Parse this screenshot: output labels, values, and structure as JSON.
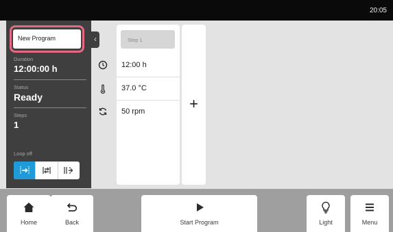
{
  "status_bar": {
    "time": "20:05"
  },
  "sidebar": {
    "program_name": "New Program",
    "duration_label": "Duration",
    "duration_value": "12:00:00 h",
    "status_label": "Status",
    "status_value": "Ready",
    "steps_label": "Steps",
    "steps_value": "1",
    "loop_label": "Loop off",
    "loop_modes": [
      {
        "icon": "loop-off-icon",
        "active": true
      },
      {
        "icon": "loop-all-icon",
        "active": false
      },
      {
        "icon": "loop-step-icon",
        "active": false
      }
    ],
    "collapse_icon": "‹"
  },
  "parameter_icons": [
    "clock-icon",
    "thermometer-icon",
    "rotation-icon"
  ],
  "step": {
    "title": "Step 1",
    "time": "12:00 h",
    "temperature": "37.0 °C",
    "speed": "50 rpm"
  },
  "add_step_label": "+",
  "nav": {
    "home": "Home",
    "back": "Back",
    "start": "Start Program",
    "light": "Light",
    "menu": "Menu"
  },
  "colors": {
    "accent": "#1e9bd8",
    "highlight": "#e46a83",
    "sidebar": "#3f3f3f",
    "background": "#e3e3e3"
  }
}
